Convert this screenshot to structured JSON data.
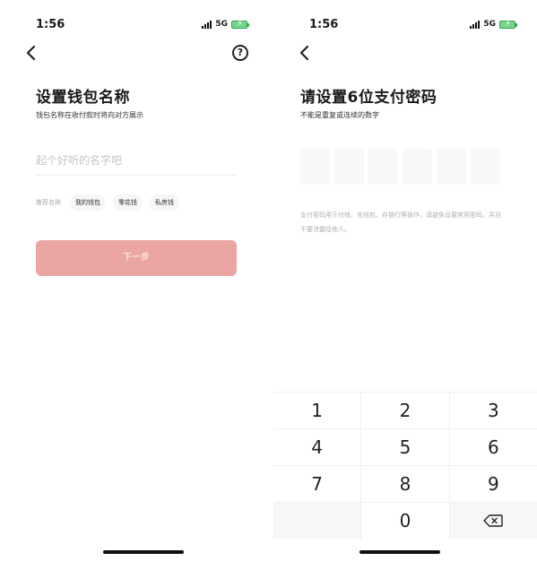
{
  "left": {
    "status": {
      "time": "1:56",
      "network": "5G"
    },
    "title": "设置钱包名称",
    "subtitle": "钱包名称在收付款时将向对方展示",
    "input": {
      "placeholder": "起个好听的名字吧",
      "value": ""
    },
    "recommend": {
      "label": "推荐名称",
      "chips": [
        "我的钱包",
        "零花钱",
        "私房钱"
      ]
    },
    "next_label": "下一步",
    "help_glyph": "?"
  },
  "right": {
    "status": {
      "time": "1:56",
      "network": "5G"
    },
    "title": "请设置6位支付密码",
    "subtitle": "不能是重复或连续的数字",
    "hint": "支付密码用于付钱、充钱包、存银行等操作，请避免设置常用密码，并且不要泄露给他人。",
    "keypad": {
      "rows": [
        [
          "1",
          "2",
          "3"
        ],
        [
          "4",
          "5",
          "6"
        ],
        [
          "7",
          "8",
          "9"
        ],
        [
          "",
          "0",
          "⌫"
        ]
      ]
    }
  },
  "colors": {
    "button_disabled": "#eba6a3",
    "pin_box": "#f7f8fa",
    "battery": "#2ca84a"
  }
}
